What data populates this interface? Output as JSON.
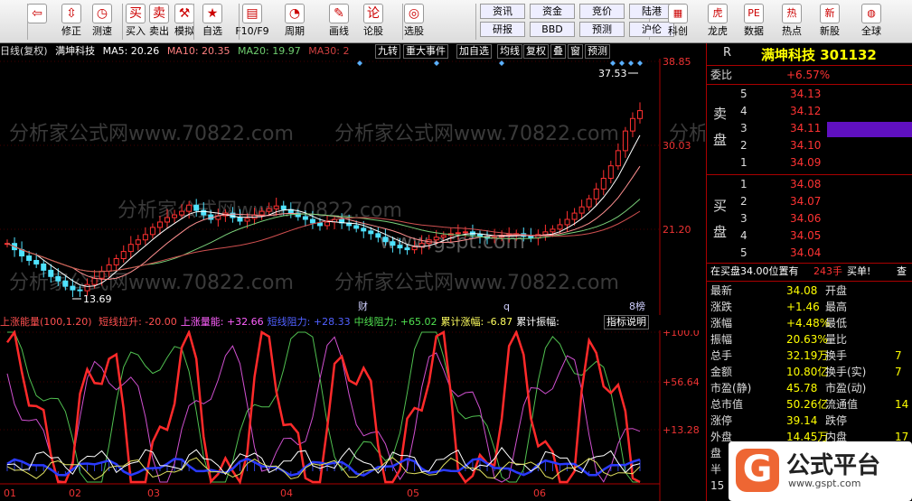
{
  "toolbar": {
    "tools": [
      {
        "label": "",
        "icon": "back-arrow-icon",
        "glyph": "⇦"
      },
      {
        "label": "修正",
        "icon": "up-down-arrows-icon",
        "glyph": "⇳"
      },
      {
        "label": "测速",
        "icon": "clock-icon",
        "glyph": "◷"
      },
      {
        "label": "买入",
        "icon": "buy-icon",
        "glyph": "买"
      },
      {
        "label": "卖出",
        "icon": "sell-icon",
        "glyph": "卖"
      },
      {
        "label": "模拟",
        "icon": "hammer-icon",
        "glyph": "⚒"
      },
      {
        "label": "自选",
        "icon": "star-folder-icon",
        "glyph": "★"
      },
      {
        "label": "F10/F9",
        "icon": "info-table-icon",
        "glyph": "▤"
      },
      {
        "label": "周期",
        "icon": "period-clock-icon",
        "glyph": "◔"
      },
      {
        "label": "画线",
        "icon": "pencil-icon",
        "glyph": "✎"
      },
      {
        "label": "论股",
        "icon": "discussion-icon",
        "glyph": "论"
      },
      {
        "label": "选股",
        "icon": "target-icon",
        "glyph": "◎"
      }
    ],
    "small_buttons": [
      "资讯",
      "资金",
      "竞价",
      "陆港",
      "研报",
      "BBD",
      "预测",
      "沪伦"
    ],
    "tools2": [
      {
        "label": "科创",
        "icon": "chart-window-icon",
        "glyph": "▦"
      },
      {
        "label": "龙虎",
        "icon": "tiger-icon",
        "glyph": "虎"
      },
      {
        "label": "数据",
        "icon": "pe-data-icon",
        "glyph": "PE"
      },
      {
        "label": "热点",
        "icon": "hot-topic-icon",
        "glyph": "热"
      },
      {
        "label": "新股",
        "icon": "new-stock-icon",
        "glyph": "新"
      },
      {
        "label": "全球",
        "icon": "globe-icon",
        "glyph": "◍"
      }
    ]
  },
  "chart": {
    "title": "日线(复权)",
    "stock": "满坤科技",
    "ma5": "MA5: 20.26",
    "ma10": "MA10: 20.35",
    "ma20": "MA20: 19.97",
    "ma30": "MA30: 2",
    "right_buttons": [
      "九转",
      "重大事件",
      "加自选",
      "均线",
      "复权",
      "叠",
      "窗",
      "预测"
    ],
    "y_labels": [
      "38.85",
      "30.03",
      "21.20"
    ],
    "high_label": "37.53",
    "low_label": "13.69",
    "markers": [
      "财",
      "q",
      "8榜"
    ],
    "watermark": "分析家公式网www.70822.com",
    "watermark2": "www.gspt.com",
    "colors": {
      "up": "#ff3030",
      "down": "#4fe3ff",
      "ma5": "#ffffff",
      "ma10": "#ff9090",
      "ma20": "#7ad07a",
      "ma30": "#d05050"
    },
    "chart_data": {
      "type": "candlestick",
      "closes": [
        19.2,
        18.5,
        17.8,
        17.3,
        16.9,
        16.2,
        15.5,
        15.0,
        14.4,
        14.0,
        13.9,
        14.6,
        15.3,
        16.1,
        16.8,
        17.5,
        18.3,
        19.1,
        19.6,
        20.2,
        21.0,
        21.6,
        22.1,
        22.4,
        22.8,
        23.5,
        22.9,
        22.4,
        21.9,
        22.3,
        22.6,
        22.1,
        21.7,
        22.0,
        22.4,
        22.8,
        23.1,
        23.4,
        23.0,
        22.6,
        22.2,
        21.9,
        21.5,
        21.2,
        21.6,
        21.9,
        21.5,
        21.2,
        20.9,
        20.6,
        20.3,
        19.9,
        19.4,
        19.0,
        18.7,
        18.5,
        18.8,
        19.2,
        19.6,
        19.9,
        20.1,
        20.3,
        20.4,
        20.5,
        20.2,
        20.0,
        19.8,
        19.9,
        20.1,
        20.2,
        20.3,
        20.0,
        19.8,
        20.2,
        20.5,
        20.8,
        21.3,
        21.9,
        22.6,
        23.3,
        24.2,
        25.3,
        26.5,
        27.9,
        29.6,
        31.8,
        33.2,
        34.08
      ]
    }
  },
  "indicator": {
    "name": "上涨能量(100,1.20)",
    "items": [
      {
        "label": "短线拉升: -20.00",
        "color": "#ff5050"
      },
      {
        "label": "上涨量能: +32.66",
        "color": "#ff60ff"
      },
      {
        "label": "短线阻力: +28.33",
        "color": "#5060ff"
      },
      {
        "label": "中线阻力: +65.02",
        "color": "#50e050"
      },
      {
        "label": "累计涨幅: -6.87",
        "color": "#ffff60"
      },
      {
        "label": "累计振幅:",
        "color": "#ffffff"
      }
    ],
    "help_label": "指标说明",
    "y_labels": [
      "+100.0",
      "+56.64",
      "+13.28"
    ],
    "x_labels": [
      "01",
      "02",
      "03",
      "04",
      "05",
      "06"
    ]
  },
  "panel": {
    "stock_name": "满坤科技",
    "code": "301132",
    "r_label": "R",
    "weibi_label": "委比",
    "weibi_value": "+6.57%",
    "sell_side": "卖盘",
    "buy_side": "买盘",
    "asks": [
      {
        "level": "5",
        "price": "34.13"
      },
      {
        "level": "4",
        "price": "34.12"
      },
      {
        "level": "3",
        "price": "34.11"
      },
      {
        "level": "2",
        "price": "34.10"
      },
      {
        "level": "1",
        "price": "34.09"
      }
    ],
    "bids": [
      {
        "level": "1",
        "price": "34.08"
      },
      {
        "level": "2",
        "price": "34.07"
      },
      {
        "level": "3",
        "price": "34.06"
      },
      {
        "level": "4",
        "price": "34.05"
      },
      {
        "level": "5",
        "price": "34.04"
      }
    ],
    "status_line": "在买盘34.00位置有",
    "status_qty": "243手",
    "status_tail": "买单!",
    "status_end": "查",
    "stats": [
      {
        "k1": "最新",
        "v1": "34.08",
        "k2": "开盘",
        "v2": ""
      },
      {
        "k1": "涨跌",
        "v1": "+1.46",
        "k2": "最高",
        "v2": ""
      },
      {
        "k1": "涨幅",
        "v1": "+4.48%",
        "k2": "最低",
        "v2": ""
      },
      {
        "k1": "振幅",
        "v1": "20.63%",
        "k2": "量比",
        "v2": ""
      },
      {
        "k1": "总手",
        "v1": "32.19万",
        "k2": "换手",
        "v2": "7"
      },
      {
        "k1": "金额",
        "v1": "10.80亿",
        "k2": "换手(实)",
        "v2": "7"
      },
      {
        "k1": "市盈(静)",
        "v1": "45.78",
        "k2": "市盈(动)",
        "v2": ""
      },
      {
        "k1": "总市值",
        "v1": "50.26亿",
        "k2": "流通值",
        "v2": "14"
      },
      {
        "k1": "涨停",
        "v1": "39.14",
        "k2": "跌停",
        "v2": ""
      },
      {
        "k1": "外盘",
        "v1": "14.45万",
        "k2": "内盘",
        "v2": "17"
      },
      {
        "k1": "盘",
        "v1": "",
        "k2": "",
        "v2": ""
      },
      {
        "k1": "半",
        "v1": "",
        "k2": "",
        "v2": ""
      },
      {
        "k1": "15",
        "v1": "",
        "k2": "",
        "v2": ""
      }
    ]
  },
  "badge": {
    "logo": "G",
    "title": "公式平台",
    "url": "www.gspt.com"
  }
}
